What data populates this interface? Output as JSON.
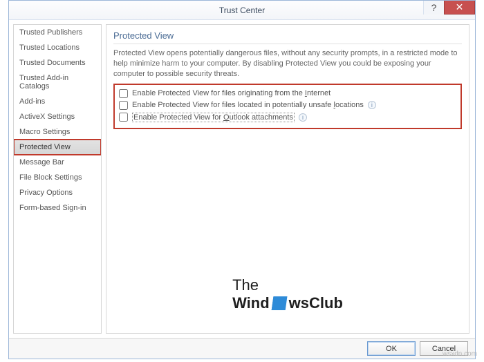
{
  "window": {
    "title": "Trust Center",
    "help_glyph": "?",
    "close_glyph": "✕"
  },
  "sidebar": {
    "items": [
      {
        "label": "Trusted Publishers",
        "selected": false
      },
      {
        "label": "Trusted Locations",
        "selected": false
      },
      {
        "label": "Trusted Documents",
        "selected": false
      },
      {
        "label": "Trusted Add-in Catalogs",
        "selected": false
      },
      {
        "label": "Add-ins",
        "selected": false
      },
      {
        "label": "ActiveX Settings",
        "selected": false
      },
      {
        "label": "Macro Settings",
        "selected": false
      },
      {
        "label": "Protected View",
        "selected": true,
        "highlight": true
      },
      {
        "label": "Message Bar",
        "selected": false
      },
      {
        "label": "File Block Settings",
        "selected": false
      },
      {
        "label": "Privacy Options",
        "selected": false
      },
      {
        "label": "Form-based Sign-in",
        "selected": false
      }
    ]
  },
  "main": {
    "heading": "Protected View",
    "description": "Protected View opens potentially dangerous files, without any security prompts, in a restricted mode to help minimize harm to your computer. By disabling Protected View you could be exposing your computer to possible security threats.",
    "options": [
      {
        "checked": false,
        "label_pre": "Enable Protected View for files originating from the ",
        "hotkey": "I",
        "label_post": "nternet",
        "info": false,
        "dotted": false
      },
      {
        "checked": false,
        "label_pre": "Enable Protected View for files located in potentially unsafe ",
        "hotkey": "l",
        "label_post": "ocations",
        "info": true,
        "dotted": false
      },
      {
        "checked": false,
        "label_pre": "Enable Protected View for ",
        "hotkey": "O",
        "label_post": "utlook attachments",
        "info": true,
        "dotted": true
      }
    ]
  },
  "watermark": {
    "line1": "The",
    "line2": "Wind",
    "line2b": "wsClub"
  },
  "attribution": "wsxdn.com",
  "footer": {
    "ok": "OK",
    "cancel": "Cancel"
  }
}
